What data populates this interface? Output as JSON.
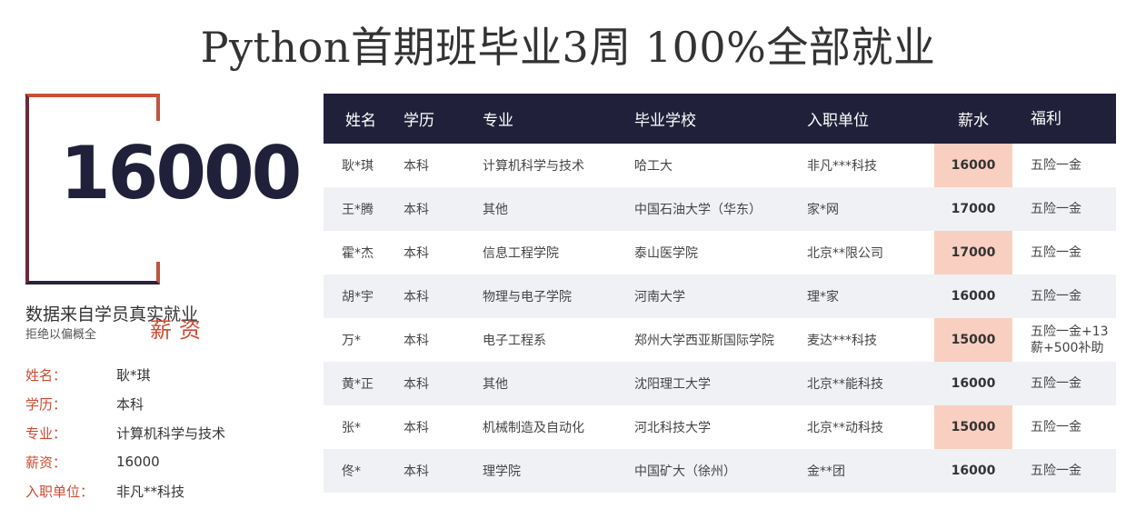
{
  "headline": "Python首期班毕业3周  100%全部就业",
  "card": {
    "salary": "16000",
    "salary_word": "薪资"
  },
  "source": {
    "title": "数据来自学员真实就业",
    "subtitle": "拒绝以偏概全"
  },
  "featured": [
    {
      "key": "姓名：",
      "value": "耿*琪"
    },
    {
      "key": "学历：",
      "value": "本科"
    },
    {
      "key": "专业：",
      "value": "计算机科学与技术"
    },
    {
      "key": "薪资：",
      "value": "16000"
    },
    {
      "key": "入职单位：",
      "value": "非凡**科技"
    }
  ],
  "table": {
    "headers": {
      "name": "姓名",
      "edu": "学历",
      "major": "专业",
      "school": "毕业学校",
      "company": "入职单位",
      "salary": "薪水",
      "benefit": "福利"
    },
    "rows": [
      {
        "name": "耿*琪",
        "edu": "本科",
        "major": "计算机科学与技术",
        "school": "哈工大",
        "company": "非凡***科技",
        "salary": "16000",
        "benefit": "五险一金"
      },
      {
        "name": "王*腾",
        "edu": "本科",
        "major": "其他",
        "school": "中国石油大学（华东）",
        "company": "家*网",
        "salary": "17000",
        "benefit": "五险一金"
      },
      {
        "name": "霍*杰",
        "edu": "本科",
        "major": "信息工程学院",
        "school": "泰山医学院",
        "company": "北京**限公司",
        "salary": "17000",
        "benefit": "五险一金"
      },
      {
        "name": "胡*宇",
        "edu": "本科",
        "major": "物理与电子学院",
        "school": "河南大学",
        "company": "理*家",
        "salary": "16000",
        "benefit": "五险一金"
      },
      {
        "name": "万*",
        "edu": "本科",
        "major": "电子工程系",
        "school": "郑州大学西亚斯国际学院",
        "company": "麦达***科技",
        "salary": "15000",
        "benefit": "五险一金+13",
        "benefit2": "薪+500补助"
      },
      {
        "name": "黄*正",
        "edu": "本科",
        "major": "其他",
        "school": "沈阳理工大学",
        "company": "北京**能科技",
        "salary": "16000",
        "benefit": "五险一金"
      },
      {
        "name": "张*",
        "edu": "本科",
        "major": "机械制造及自动化",
        "school": "河北科技大学",
        "company": "北京**动科技",
        "salary": "15000",
        "benefit": "五险一金"
      },
      {
        "name": "佟*",
        "edu": "本科",
        "major": "理学院",
        "school": "中国矿大（徐州）",
        "company": "金**团",
        "salary": "16000",
        "benefit": "五险一金"
      }
    ]
  },
  "colors": {
    "navy": "#20203a",
    "accent": "#d04a30",
    "salary_highlight": "#f9cfc1",
    "alt_row": "#f0f1f5"
  }
}
